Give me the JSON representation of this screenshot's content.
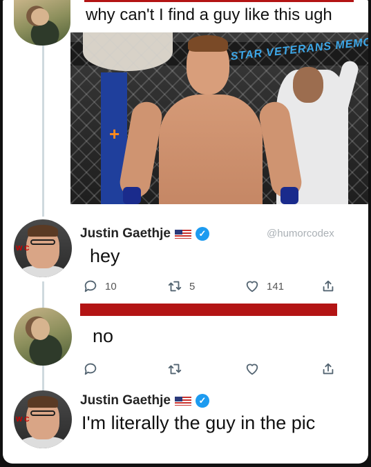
{
  "tweet1": {
    "text": "why can't I find a guy like this ugh"
  },
  "photo": {
    "banner_text": "STAR VETERANS MEMORIAL",
    "post_text": "+"
  },
  "tweet2": {
    "name": "Justin Gaethje",
    "watermark": "@humorcodex",
    "text": "hey",
    "replies": "10",
    "retweets": "5",
    "likes": "141",
    "avatar_ring_text": "W C"
  },
  "tweet3": {
    "text": "no"
  },
  "tweet4": {
    "name": "Justin Gaethje",
    "text": "I'm literally the guy in the pic",
    "avatar_ring_text": "W C"
  },
  "colors": {
    "verified": "#1d9bf0",
    "redaction": "#b31414",
    "icon": "#536471"
  }
}
